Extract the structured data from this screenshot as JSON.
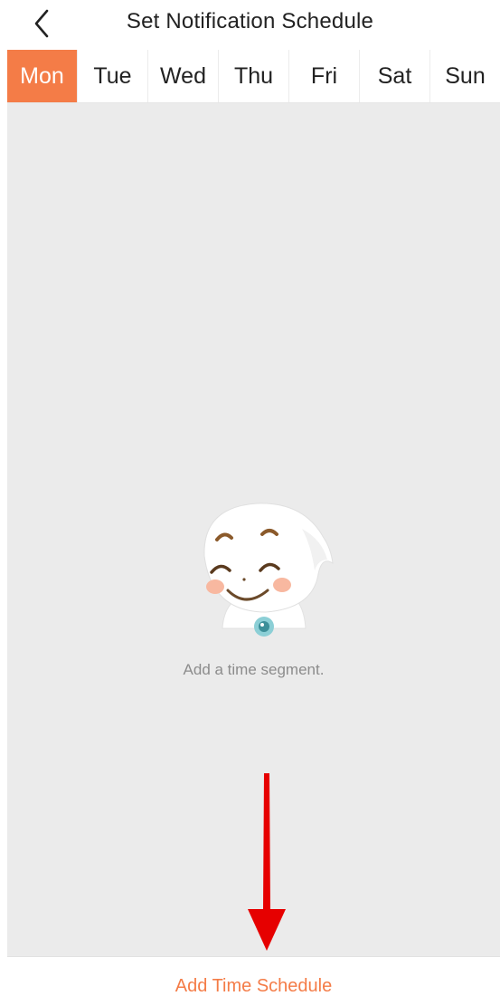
{
  "header": {
    "title": "Set Notification Schedule",
    "back_icon": "chevron-left-icon"
  },
  "day_tabs": [
    {
      "label": "Mon",
      "selected": true
    },
    {
      "label": "Tue",
      "selected": false
    },
    {
      "label": "Wed",
      "selected": false
    },
    {
      "label": "Thu",
      "selected": false
    },
    {
      "label": "Fri",
      "selected": false
    },
    {
      "label": "Sat",
      "selected": false
    },
    {
      "label": "Sun",
      "selected": false
    }
  ],
  "empty_state": {
    "message": "Add a time segment.",
    "illustration": "smiling-mascot-illustration"
  },
  "annotation": {
    "icon": "red-arrow-down-icon",
    "color": "#e60000"
  },
  "footer": {
    "add_label": "Add Time Schedule"
  },
  "colors": {
    "accent": "#f47c47",
    "background": "#ebebeb"
  }
}
